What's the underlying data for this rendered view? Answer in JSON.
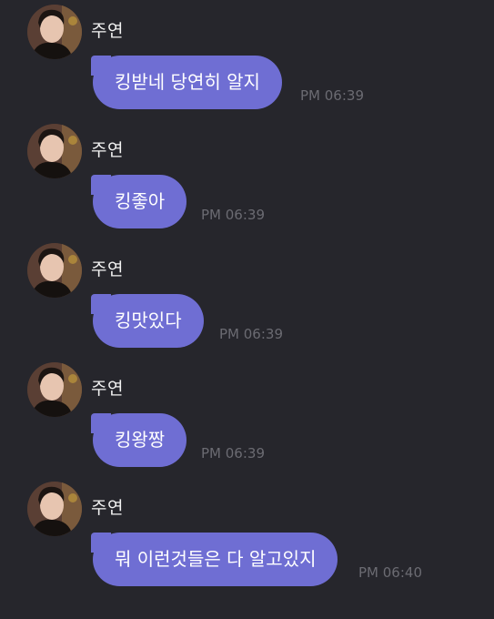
{
  "messages": [
    {
      "sender": "주연",
      "text": "킹받네 당연히 알지",
      "time": "PM 06:39"
    },
    {
      "sender": "주연",
      "text": "킹좋아",
      "time": "PM 06:39"
    },
    {
      "sender": "주연",
      "text": "킹맛있다",
      "time": "PM 06:39"
    },
    {
      "sender": "주연",
      "text": "킹왕짱",
      "time": "PM 06:39"
    },
    {
      "sender": "주연",
      "text": "뭐 이런것들은 다 알고있지",
      "time": "PM 06:40"
    }
  ],
  "colors": {
    "background": "#26262c",
    "bubble": "#6f6ed3",
    "bubble_text": "#ffffff",
    "sender_text": "#f2f2f2",
    "time_text": "#6b6b72"
  }
}
